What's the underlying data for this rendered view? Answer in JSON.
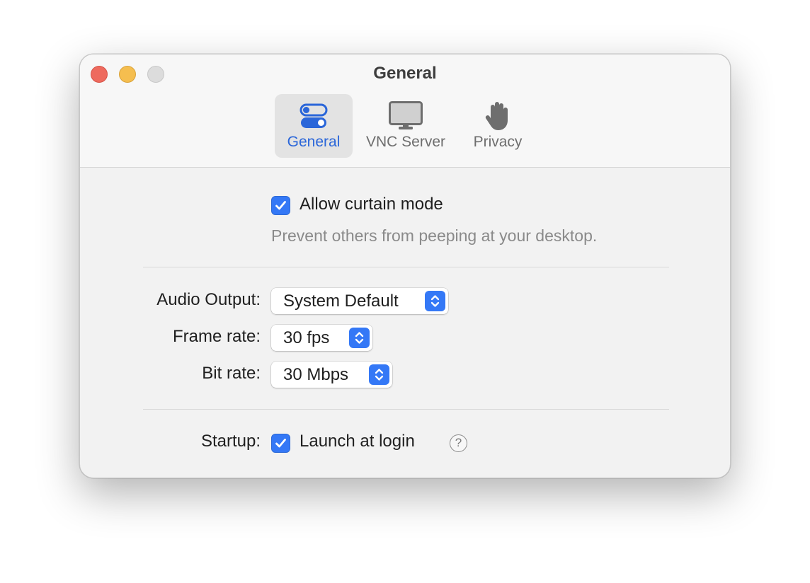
{
  "window": {
    "title": "General"
  },
  "toolbar": {
    "tabs": [
      {
        "label": "General",
        "icon": "toggles-icon",
        "active": true
      },
      {
        "label": "VNC Server",
        "icon": "display-icon",
        "active": false
      },
      {
        "label": "Privacy",
        "icon": "hand-icon",
        "active": false
      }
    ]
  },
  "curtain": {
    "checkbox_label": "Allow curtain mode",
    "checked": true,
    "description": "Prevent others from peeping at your desktop."
  },
  "settings": {
    "audio_output": {
      "label": "Audio Output:",
      "value": "System Default"
    },
    "frame_rate": {
      "label": "Frame rate:",
      "value": "30 fps"
    },
    "bit_rate": {
      "label": "Bit rate:",
      "value": "30 Mbps"
    }
  },
  "startup": {
    "label": "Startup:",
    "checkbox_label": "Launch at login",
    "checked": true,
    "help": "?"
  },
  "colors": {
    "accent": "#3478f6",
    "active_tab_text": "#2a66d9",
    "close": "#ee6a5e",
    "minimize": "#f5be4f",
    "zoom": "#dcdcdc"
  }
}
